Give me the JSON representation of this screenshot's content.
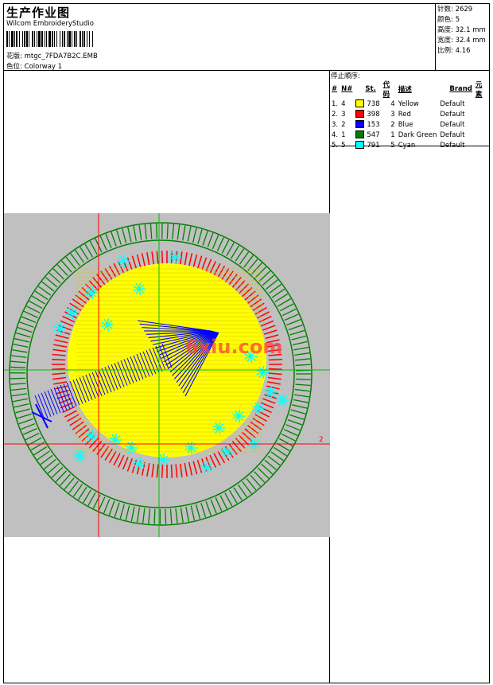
{
  "header": {
    "title": "生产作业图",
    "software": "Wilcom EmbroideryStudio",
    "design_label": "花版:",
    "design_file": "mtgc_7FDA7B2C.EMB",
    "colorway_label": "色位:",
    "colorway": "Colorway 1"
  },
  "stats": [
    {
      "label": "针数:",
      "value": "2629"
    },
    {
      "label": "颜色:",
      "value": "5"
    },
    {
      "label": "高度:",
      "value": "32.1 mm"
    },
    {
      "label": "宽度:",
      "value": "32.4 mm"
    },
    {
      "label": "比例:",
      "value": "4.16"
    }
  ],
  "stop_sequence": {
    "title": "停止顺序:",
    "columns": [
      "#",
      "N#",
      "St.",
      "代码",
      "描述",
      "Brand",
      "元素"
    ],
    "rows": [
      {
        "idx": "1.",
        "n": "4",
        "color": "#ffff00",
        "stitches": "738",
        "code": "4",
        "desc": "Yellow",
        "brand": "Default"
      },
      {
        "idx": "2.",
        "n": "3",
        "color": "#ff0000",
        "stitches": "398",
        "code": "3",
        "desc": "Red",
        "brand": "Default"
      },
      {
        "idx": "3.",
        "n": "2",
        "color": "#0000ff",
        "stitches": "153",
        "code": "2",
        "desc": "Blue",
        "brand": "Default"
      },
      {
        "idx": "4.",
        "n": "1",
        "color": "#008000",
        "stitches": "547",
        "code": "1",
        "desc": "Dark Green",
        "brand": "Default"
      },
      {
        "idx": "5.",
        "n": "5",
        "color": "#00ffff",
        "stitches": "791",
        "code": "5",
        "desc": "Cyan",
        "brand": "Default"
      }
    ]
  },
  "canvas": {
    "background": "#c0c0c0",
    "marker_label": "2",
    "watermark": "6xiu.com"
  }
}
